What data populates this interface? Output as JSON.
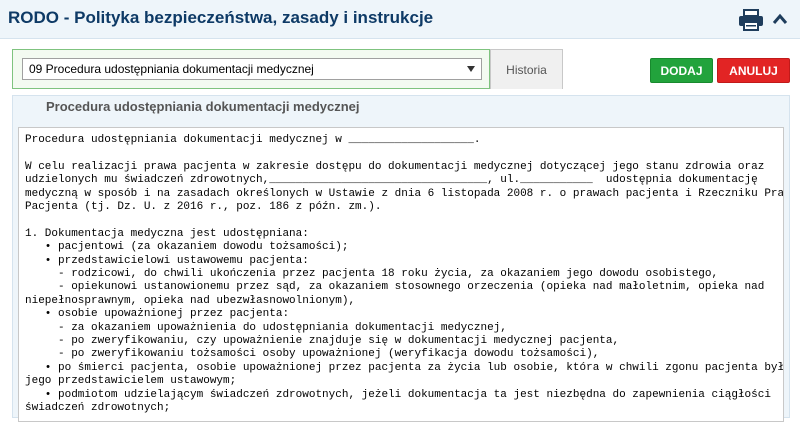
{
  "header": {
    "title": "RODO - Polityka bezpieczeństwa, zasady i instrukcje",
    "print_icon": "printer-icon",
    "collapse_icon": "chevron-up-icon"
  },
  "toolbar": {
    "selected_document": "09 Procedura udostępniania dokumentacji medycznej",
    "history_tab": "Historia",
    "add_label": "DODAJ",
    "cancel_label": "ANULUJ"
  },
  "colors": {
    "header_bg": "#eef5fa",
    "title": "#0e3a66",
    "add_button": "#22a33c",
    "cancel_button": "#e22424"
  },
  "document": {
    "heading": "Procedura udostępniania dokumentacji medycznej",
    "lines": [
      "Procedura udostępniania dokumentacji medycznej w ___________________.",
      "",
      "W celu realizacji prawa pacjenta w zakresie dostępu do dokumentacji medycznej dotyczącej jego stanu zdrowia oraz",
      "udzielonych mu świadczeń zdrowotnych,_________________________________, ul.___________  udostępnia dokumentację",
      "medyczną w sposób i na zasadach określonych w Ustawie z dnia 6 listopada 2008 r. o prawach pacjenta i Rzeczniku Praw",
      "Pacjenta (tj. Dz. U. z 2016 r., poz. 186 z późn. zm.).",
      "",
      "1. Dokumentacja medyczna jest udostępniana:",
      "   • pacjentowi (za okazaniem dowodu tożsamości);",
      "   • przedstawicielowi ustawowemu pacjenta:",
      "     - rodzicowi, do chwili ukończenia przez pacjenta 18 roku życia, za okazaniem jego dowodu osobistego,",
      "     - opiekunowi ustanowionemu przez sąd, za okazaniem stosownego orzeczenia (opieka nad małoletnim, opieka nad",
      "niepełnosprawnym, opieka nad ubezwłasnowolnionym),",
      "   • osobie upoważnionej przez pacjenta:",
      "     - za okazaniem upoważnienia do udostępniania dokumentacji medycznej,",
      "     - po zweryfikowaniu, czy upoważnienie znajduje się w dokumentacji medycznej pacjenta,",
      "     - po zweryfikowaniu tożsamości osoby upoważnionej (weryfikacja dowodu tożsamości),",
      "   • po śmierci pacjenta, osobie upoważnionej przez pacjenta za życia lub osobie, która w chwili zgonu pacjenta była",
      "jego przedstawicielem ustawowym;",
      "   • podmiotom udzielającym świadczeń zdrowotnych, jeżeli dokumentacja ta jest niezbędna do zapewnienia ciągłości",
      "świadczeń zdrowotnych;"
    ]
  }
}
